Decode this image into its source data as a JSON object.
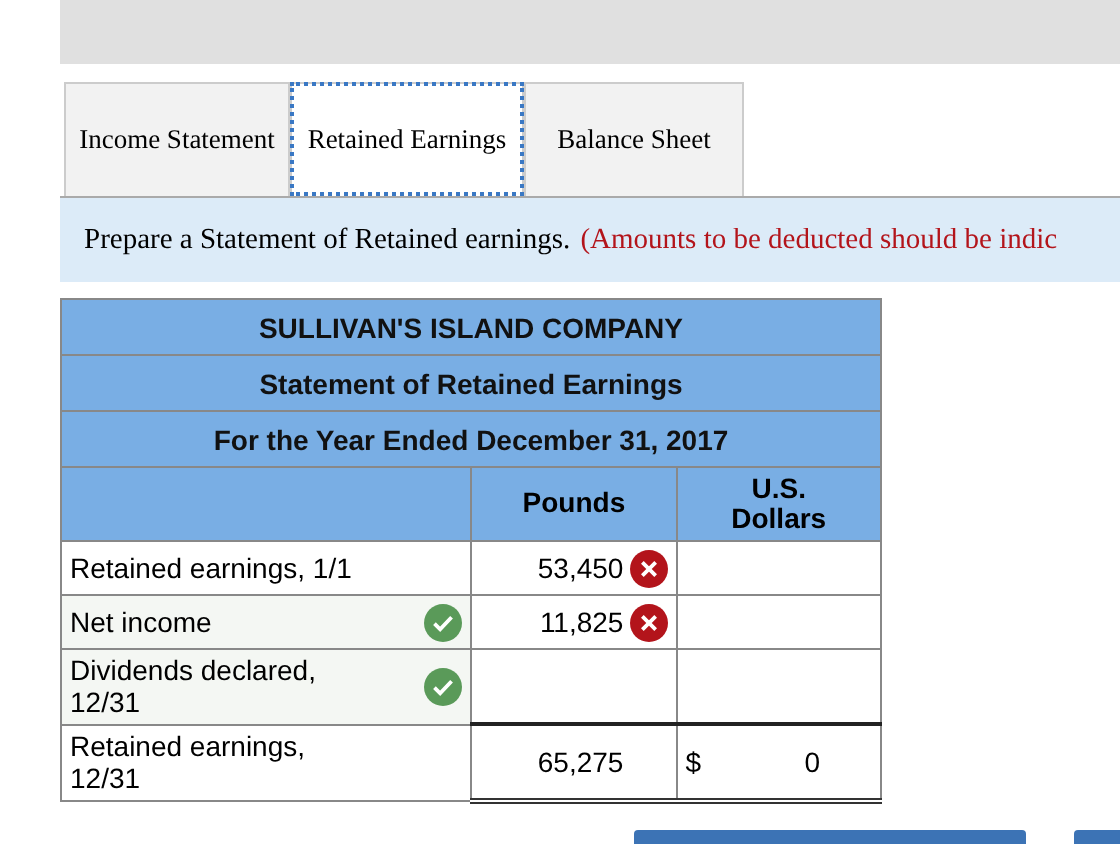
{
  "tabs": [
    {
      "label": "Income Statement",
      "selected": false
    },
    {
      "label": "Retained Earnings",
      "selected": true
    },
    {
      "label": "Balance Sheet",
      "selected": false
    }
  ],
  "instruction": {
    "text": "Prepare a Statement of Retained earnings.",
    "note": "(Amounts to be deducted should be indic"
  },
  "table": {
    "titles": [
      "SULLIVAN'S ISLAND COMPANY",
      "Statement of Retained Earnings",
      "For the Year Ended December 31, 2017"
    ],
    "columns": [
      "Pounds",
      "U.S. Dollars"
    ],
    "rows": [
      {
        "label": "Retained earnings, 1/1",
        "label_correct": false,
        "pounds": "53,450",
        "pounds_incorrect": true,
        "kind": "line"
      },
      {
        "label": "Net income",
        "label_correct": true,
        "pounds": "11,825",
        "pounds_incorrect": true,
        "kind": "line"
      },
      {
        "label": "Dividends declared, 12/31",
        "label_correct": true,
        "pounds_incorrect": false,
        "kind": "subtotal"
      },
      {
        "label": "Retained earnings, 12/31",
        "label_correct": false,
        "pounds": "65,275",
        "pounds_incorrect": false,
        "currency": "$",
        "dollars": "0",
        "kind": "total"
      }
    ]
  },
  "buttons": [
    {
      "kind": "primary"
    },
    {
      "kind": "primary"
    }
  ]
}
